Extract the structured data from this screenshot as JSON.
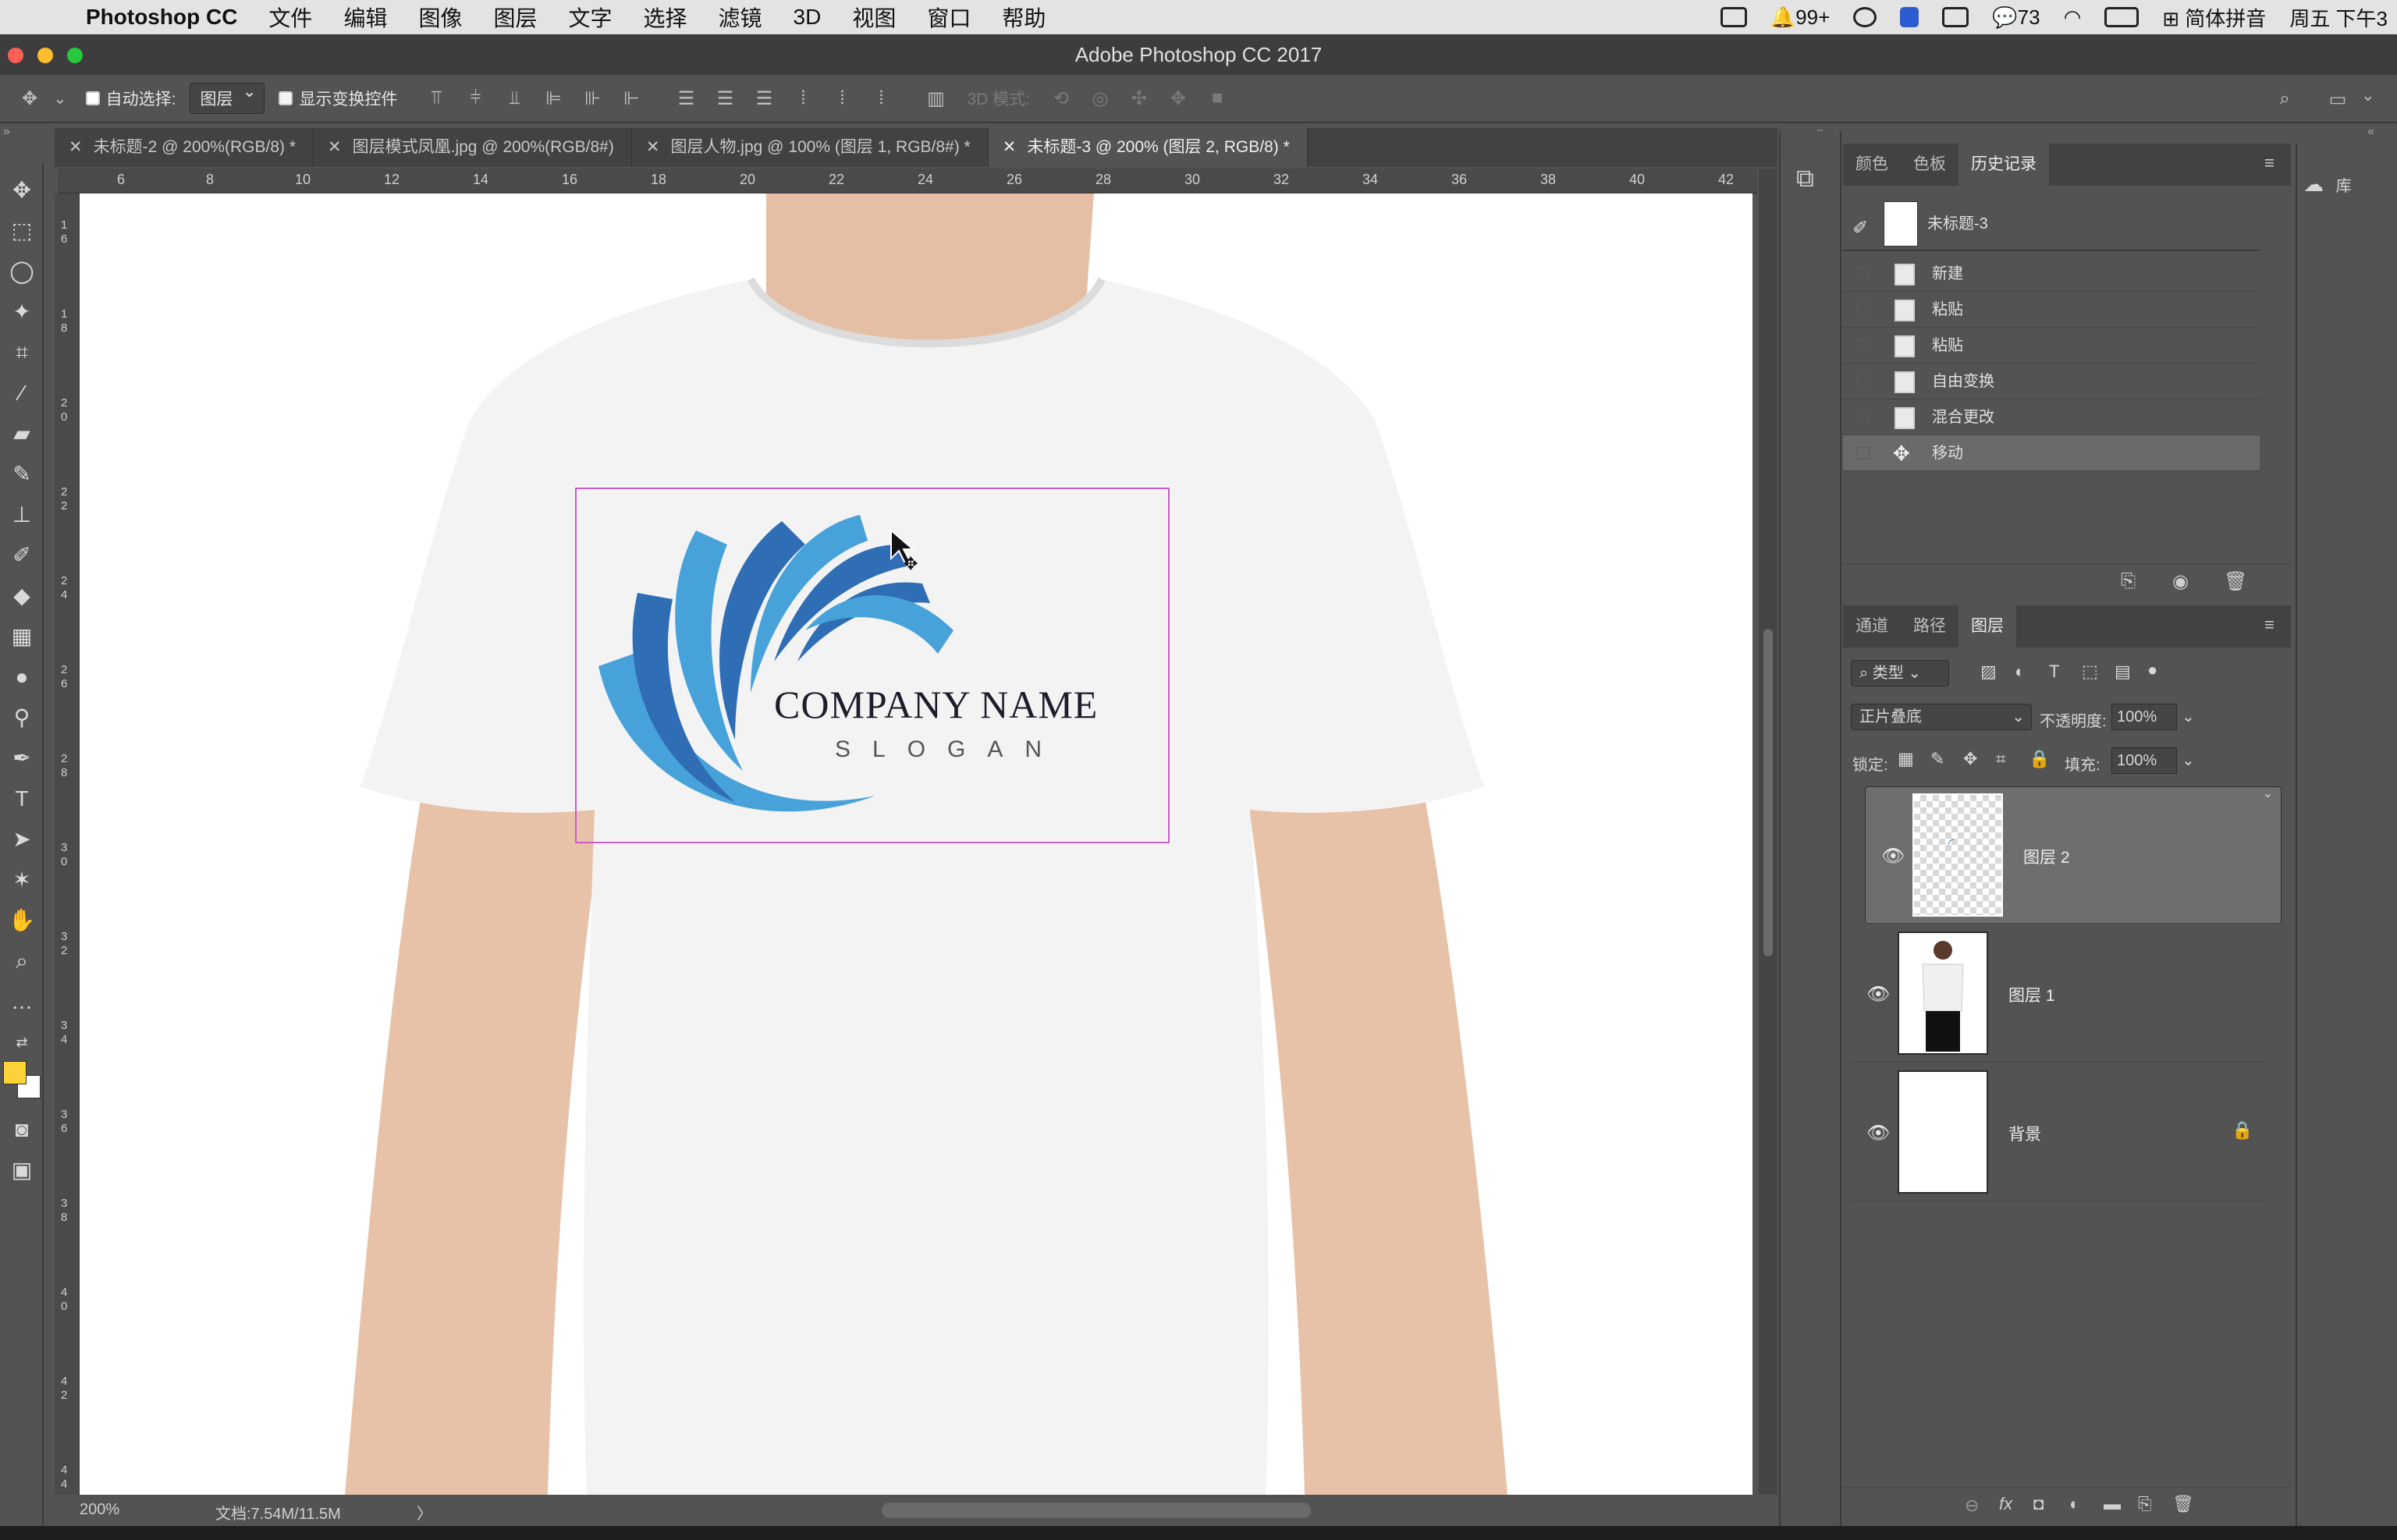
{
  "menubar": {
    "app": "Photoshop CC",
    "items": [
      "文件",
      "编辑",
      "图像",
      "图层",
      "文字",
      "选择",
      "滤镜",
      "3D",
      "视图",
      "窗口",
      "帮助"
    ],
    "notifications": "99+",
    "wechat": "73",
    "ime": "简体拼音",
    "clock": "周五 下午3"
  },
  "window": {
    "title": "Adobe Photoshop CC 2017"
  },
  "options": {
    "auto_select_label": "自动选择:",
    "auto_select_value": "图层",
    "show_transform_label": "显示变换控件",
    "mode_3d_label": "3D 模式:"
  },
  "tabs": [
    {
      "label": "未标题-2 @ 200%(RGB/8) *",
      "active": false
    },
    {
      "label": "图层模式凤凰.jpg @ 200%(RGB/8#)",
      "active": false
    },
    {
      "label": "图层人物.jpg @ 100% (图层 1, RGB/8#) *",
      "active": false
    },
    {
      "label": "未标题-3 @ 200% (图层 2, RGB/8) *",
      "active": true
    }
  ],
  "ruler": {
    "top": [
      "6",
      "8",
      "10",
      "12",
      "14",
      "16",
      "18",
      "20",
      "22",
      "24",
      "26",
      "28",
      "30",
      "32",
      "34",
      "36",
      "38",
      "40",
      "42"
    ],
    "left": [
      "1\n6",
      "1\n8",
      "2\n0",
      "2\n2",
      "2\n4",
      "2\n6",
      "2\n8",
      "3\n0",
      "3\n2",
      "3\n4",
      "3\n6",
      "3\n8",
      "4\n0",
      "4\n2",
      "4\n4"
    ]
  },
  "canvas": {
    "logo_company": "COMPANY NAME",
    "logo_slogan": "SLOGAN"
  },
  "status": {
    "zoom": "200%",
    "doc": "文档:7.54M/11.5M",
    "arrow": "〉"
  },
  "history": {
    "tabs": [
      "颜色",
      "色板",
      "历史记录"
    ],
    "active_tab": 2,
    "snapshot": "未标题-3",
    "steps": [
      "新建",
      "粘贴",
      "粘贴",
      "自由变换",
      "混合更改",
      "移动"
    ],
    "selected_step": 5
  },
  "layers_panel": {
    "tabs": [
      "通道",
      "路径",
      "图层"
    ],
    "active_tab": 2,
    "filter": "类型",
    "blend_mode": "正片叠底",
    "opacity_label": "不透明度:",
    "opacity": "100%",
    "lock_label": "锁定:",
    "fill_label": "填充:",
    "fill": "100%",
    "layers": [
      {
        "name": "图层 2",
        "selected": true
      },
      {
        "name": "图层 1",
        "selected": false
      },
      {
        "name": "背景",
        "selected": false
      }
    ]
  },
  "library": {
    "label": "库"
  },
  "colors": {
    "foreground": "#ffd23a",
    "background": "#ffffff",
    "logo_dark": "#2f6db4",
    "logo_light": "#48a2da",
    "selection": "#c45ec8"
  }
}
